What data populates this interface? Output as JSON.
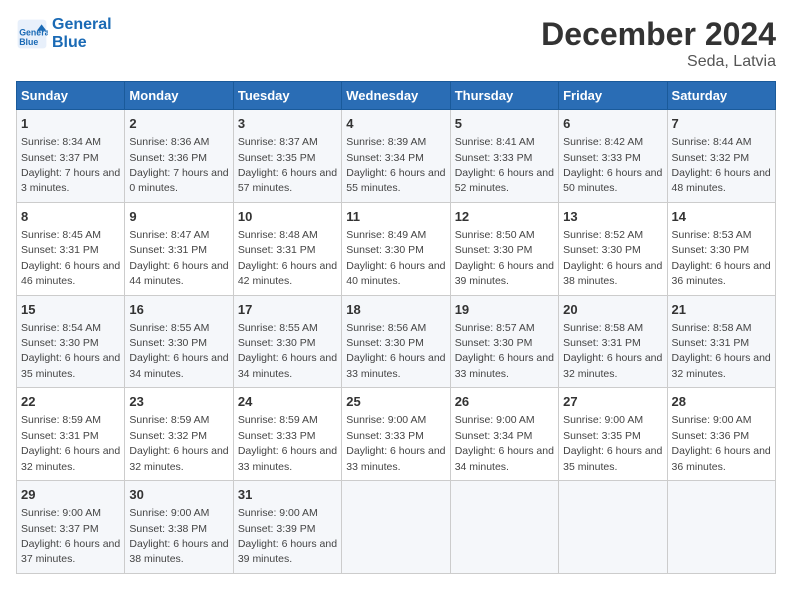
{
  "header": {
    "logo_line1": "General",
    "logo_line2": "Blue",
    "month": "December 2024",
    "location": "Seda, Latvia"
  },
  "days_of_week": [
    "Sunday",
    "Monday",
    "Tuesday",
    "Wednesday",
    "Thursday",
    "Friday",
    "Saturday"
  ],
  "weeks": [
    [
      {
        "num": "1",
        "sunrise": "Sunrise: 8:34 AM",
        "sunset": "Sunset: 3:37 PM",
        "daylight": "Daylight: 7 hours and 3 minutes."
      },
      {
        "num": "2",
        "sunrise": "Sunrise: 8:36 AM",
        "sunset": "Sunset: 3:36 PM",
        "daylight": "Daylight: 7 hours and 0 minutes."
      },
      {
        "num": "3",
        "sunrise": "Sunrise: 8:37 AM",
        "sunset": "Sunset: 3:35 PM",
        "daylight": "Daylight: 6 hours and 57 minutes."
      },
      {
        "num": "4",
        "sunrise": "Sunrise: 8:39 AM",
        "sunset": "Sunset: 3:34 PM",
        "daylight": "Daylight: 6 hours and 55 minutes."
      },
      {
        "num": "5",
        "sunrise": "Sunrise: 8:41 AM",
        "sunset": "Sunset: 3:33 PM",
        "daylight": "Daylight: 6 hours and 52 minutes."
      },
      {
        "num": "6",
        "sunrise": "Sunrise: 8:42 AM",
        "sunset": "Sunset: 3:33 PM",
        "daylight": "Daylight: 6 hours and 50 minutes."
      },
      {
        "num": "7",
        "sunrise": "Sunrise: 8:44 AM",
        "sunset": "Sunset: 3:32 PM",
        "daylight": "Daylight: 6 hours and 48 minutes."
      }
    ],
    [
      {
        "num": "8",
        "sunrise": "Sunrise: 8:45 AM",
        "sunset": "Sunset: 3:31 PM",
        "daylight": "Daylight: 6 hours and 46 minutes."
      },
      {
        "num": "9",
        "sunrise": "Sunrise: 8:47 AM",
        "sunset": "Sunset: 3:31 PM",
        "daylight": "Daylight: 6 hours and 44 minutes."
      },
      {
        "num": "10",
        "sunrise": "Sunrise: 8:48 AM",
        "sunset": "Sunset: 3:31 PM",
        "daylight": "Daylight: 6 hours and 42 minutes."
      },
      {
        "num": "11",
        "sunrise": "Sunrise: 8:49 AM",
        "sunset": "Sunset: 3:30 PM",
        "daylight": "Daylight: 6 hours and 40 minutes."
      },
      {
        "num": "12",
        "sunrise": "Sunrise: 8:50 AM",
        "sunset": "Sunset: 3:30 PM",
        "daylight": "Daylight: 6 hours and 39 minutes."
      },
      {
        "num": "13",
        "sunrise": "Sunrise: 8:52 AM",
        "sunset": "Sunset: 3:30 PM",
        "daylight": "Daylight: 6 hours and 38 minutes."
      },
      {
        "num": "14",
        "sunrise": "Sunrise: 8:53 AM",
        "sunset": "Sunset: 3:30 PM",
        "daylight": "Daylight: 6 hours and 36 minutes."
      }
    ],
    [
      {
        "num": "15",
        "sunrise": "Sunrise: 8:54 AM",
        "sunset": "Sunset: 3:30 PM",
        "daylight": "Daylight: 6 hours and 35 minutes."
      },
      {
        "num": "16",
        "sunrise": "Sunrise: 8:55 AM",
        "sunset": "Sunset: 3:30 PM",
        "daylight": "Daylight: 6 hours and 34 minutes."
      },
      {
        "num": "17",
        "sunrise": "Sunrise: 8:55 AM",
        "sunset": "Sunset: 3:30 PM",
        "daylight": "Daylight: 6 hours and 34 minutes."
      },
      {
        "num": "18",
        "sunrise": "Sunrise: 8:56 AM",
        "sunset": "Sunset: 3:30 PM",
        "daylight": "Daylight: 6 hours and 33 minutes."
      },
      {
        "num": "19",
        "sunrise": "Sunrise: 8:57 AM",
        "sunset": "Sunset: 3:30 PM",
        "daylight": "Daylight: 6 hours and 33 minutes."
      },
      {
        "num": "20",
        "sunrise": "Sunrise: 8:58 AM",
        "sunset": "Sunset: 3:31 PM",
        "daylight": "Daylight: 6 hours and 32 minutes."
      },
      {
        "num": "21",
        "sunrise": "Sunrise: 8:58 AM",
        "sunset": "Sunset: 3:31 PM",
        "daylight": "Daylight: 6 hours and 32 minutes."
      }
    ],
    [
      {
        "num": "22",
        "sunrise": "Sunrise: 8:59 AM",
        "sunset": "Sunset: 3:31 PM",
        "daylight": "Daylight: 6 hours and 32 minutes."
      },
      {
        "num": "23",
        "sunrise": "Sunrise: 8:59 AM",
        "sunset": "Sunset: 3:32 PM",
        "daylight": "Daylight: 6 hours and 32 minutes."
      },
      {
        "num": "24",
        "sunrise": "Sunrise: 8:59 AM",
        "sunset": "Sunset: 3:33 PM",
        "daylight": "Daylight: 6 hours and 33 minutes."
      },
      {
        "num": "25",
        "sunrise": "Sunrise: 9:00 AM",
        "sunset": "Sunset: 3:33 PM",
        "daylight": "Daylight: 6 hours and 33 minutes."
      },
      {
        "num": "26",
        "sunrise": "Sunrise: 9:00 AM",
        "sunset": "Sunset: 3:34 PM",
        "daylight": "Daylight: 6 hours and 34 minutes."
      },
      {
        "num": "27",
        "sunrise": "Sunrise: 9:00 AM",
        "sunset": "Sunset: 3:35 PM",
        "daylight": "Daylight: 6 hours and 35 minutes."
      },
      {
        "num": "28",
        "sunrise": "Sunrise: 9:00 AM",
        "sunset": "Sunset: 3:36 PM",
        "daylight": "Daylight: 6 hours and 36 minutes."
      }
    ],
    [
      {
        "num": "29",
        "sunrise": "Sunrise: 9:00 AM",
        "sunset": "Sunset: 3:37 PM",
        "daylight": "Daylight: 6 hours and 37 minutes."
      },
      {
        "num": "30",
        "sunrise": "Sunrise: 9:00 AM",
        "sunset": "Sunset: 3:38 PM",
        "daylight": "Daylight: 6 hours and 38 minutes."
      },
      {
        "num": "31",
        "sunrise": "Sunrise: 9:00 AM",
        "sunset": "Sunset: 3:39 PM",
        "daylight": "Daylight: 6 hours and 39 minutes."
      },
      null,
      null,
      null,
      null
    ]
  ]
}
